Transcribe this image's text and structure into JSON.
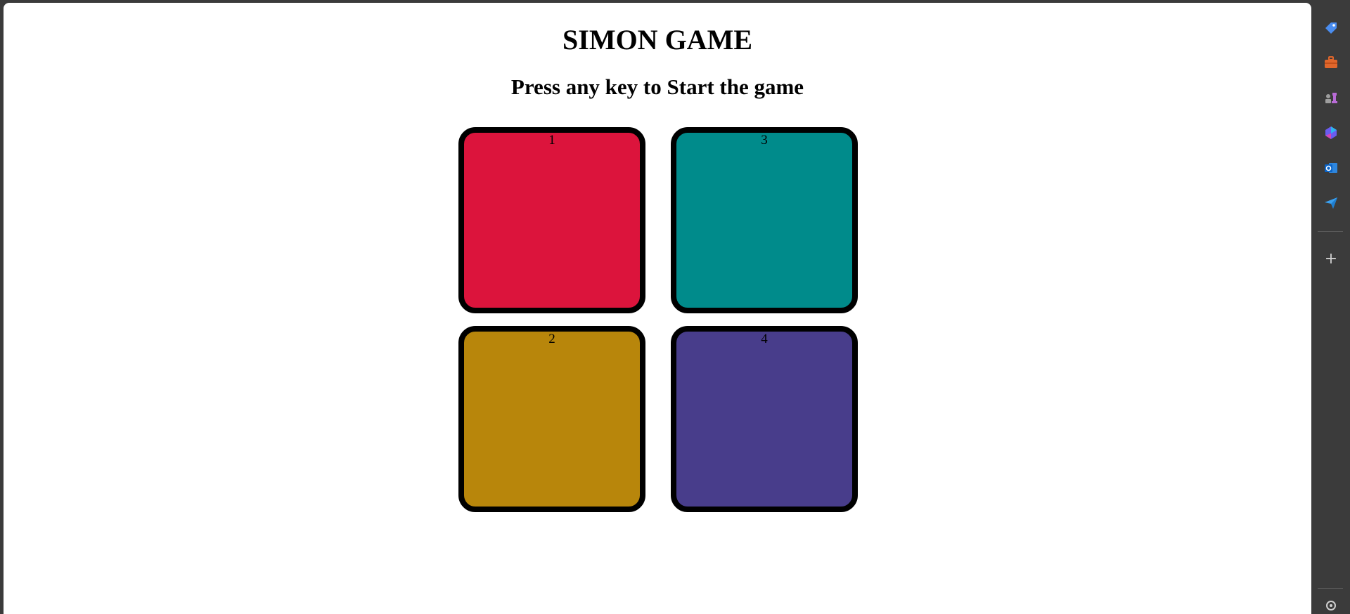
{
  "game": {
    "title": "SIMON GAME",
    "status": "Press any key to Start the game",
    "buttons": [
      {
        "label": "1",
        "color": "#DC143C"
      },
      {
        "label": "3",
        "color": "#008B8B"
      },
      {
        "label": "2",
        "color": "#B8860B"
      },
      {
        "label": "4",
        "color": "#483D8B"
      }
    ]
  },
  "sidebar": {
    "icons": [
      "tag-icon",
      "briefcase-icon",
      "chess-icon",
      "copilot-icon",
      "outlook-icon",
      "send-icon",
      "add-icon",
      "settings-icon"
    ],
    "add_label": "+"
  }
}
